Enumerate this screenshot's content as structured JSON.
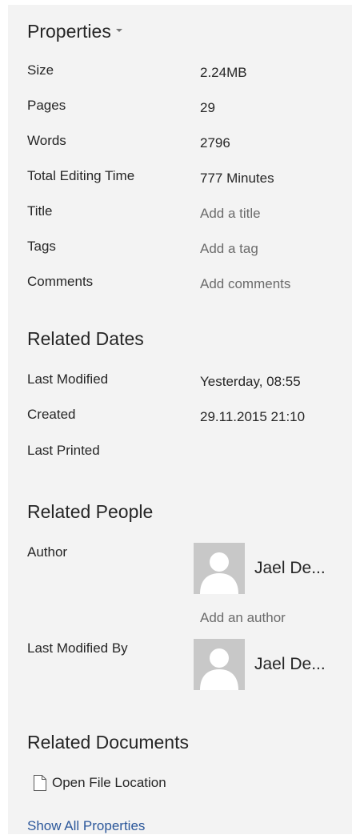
{
  "properties": {
    "title": "Properties",
    "rows": [
      {
        "label": "Size",
        "value": "2.24MB"
      },
      {
        "label": "Pages",
        "value": "29"
      },
      {
        "label": "Words",
        "value": "2796"
      },
      {
        "label": "Total Editing Time",
        "value": "777 Minutes"
      },
      {
        "label": "Title",
        "value": "Add a title"
      },
      {
        "label": "Tags",
        "value": "Add a tag"
      },
      {
        "label": "Comments",
        "value": "Add comments"
      }
    ]
  },
  "dates": {
    "title": "Related Dates",
    "rows": [
      {
        "label": "Last Modified",
        "value": "Yesterday, 08:55"
      },
      {
        "label": "Created",
        "value": "29.11.2015 21:10"
      },
      {
        "label": "Last Printed",
        "value": ""
      }
    ]
  },
  "people": {
    "title": "Related People",
    "author_label": "Author",
    "author_name": "Jael De...",
    "add_author": "Add an author",
    "modified_by_label": "Last Modified By",
    "modified_by_name": "Jael De..."
  },
  "documents": {
    "title": "Related Documents",
    "open_file_location": "Open File Location"
  },
  "show_all_properties": "Show All Properties",
  "colors": {
    "panel_background": "#f3f3f3",
    "link": "#2b579a",
    "placeholder_text": "#6b6b6b",
    "avatar_background": "#c8c8c8"
  },
  "icons": {
    "dropdown": "caret-down-icon",
    "avatar": "person-silhouette-icon",
    "file": "document-icon"
  }
}
